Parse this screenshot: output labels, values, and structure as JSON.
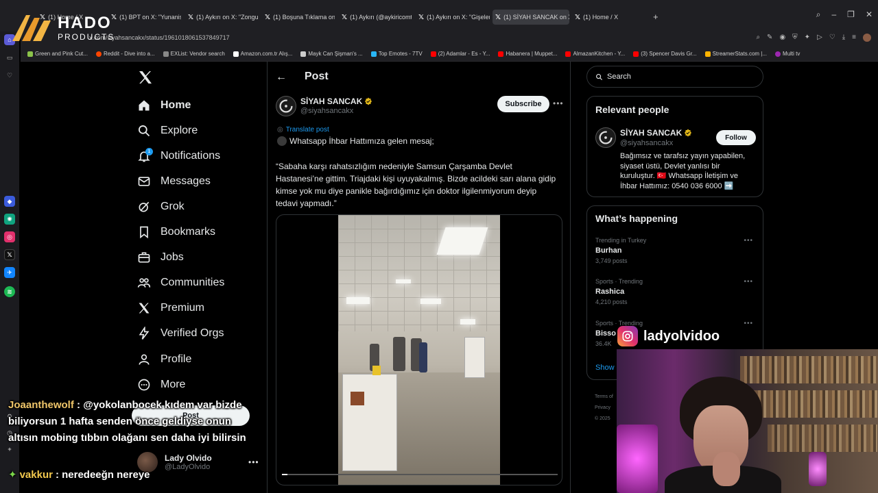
{
  "browser": {
    "tabs": [
      {
        "label": "(1) Home / X",
        "active": false
      },
      {
        "label": "(1) BPT on X: \"Yunanistan",
        "active": false
      },
      {
        "label": "(1) Aykırı on X: \"Zongulda",
        "active": false
      },
      {
        "label": "(1) Boşuna Tıklama on X: \"",
        "active": false
      },
      {
        "label": "(1) Aykırı (@aykiricomtr) /",
        "active": false
      },
      {
        "label": "(1) Aykırı on X: \"Gişelerde",
        "active": false
      },
      {
        "label": "(1) SİYAH SANCAK on X: \"",
        "active": true
      },
      {
        "label": "(1) Home / X",
        "active": false
      }
    ],
    "url": "x.com/siyahsancakx/status/1961018061537849717",
    "bookmarks": [
      "Green and Pink Cut...",
      "Reddit - Dive into a...",
      "EXList: Vendor search",
      "Amazon.com.tr Alış...",
      "Mayk Can Şişman's ...",
      "Top Emotes - 7TV",
      "(2) Adamlar - Es - Y...",
      "Habanera | Muppet...",
      "AlmazanKitchen - Y...",
      "(3) Spencer Davis Gr...",
      "StreamerStats.com |...",
      "Multi tv"
    ]
  },
  "logo": {
    "name": "HADO",
    "sub": "PRODUCTS"
  },
  "nav": {
    "items": [
      "Home",
      "Explore",
      "Notifications",
      "Messages",
      "Grok",
      "Bookmarks",
      "Jobs",
      "Communities",
      "Premium",
      "Verified Orgs",
      "Profile",
      "More"
    ],
    "notifications_badge": "1",
    "post_label": "Post",
    "account_name": "Lady Olvido",
    "account_handle": "@LadyOlvido"
  },
  "post": {
    "header": "Post",
    "author_name": "SİYAH SANCAK",
    "author_handle": "@siyahsancakx",
    "subscribe_label": "Subscribe",
    "translate_label": "Translate post",
    "line1": "Whatsapp İhbar Hattımıza gelen mesaj;",
    "body": "“Sabaha karşı rahatsızlığım nedeniyle Samsun Çarşamba Devlet Hastanesi’ne gittim. Triajdaki kişi uyuyakalmış. Bizde acildeki sarı alana gidip kimse yok mu diye panikle bağırdığımız için doktor ilgilenmiyorum deyip tedavi yapmadı.”",
    "video_progress": 0.02
  },
  "right": {
    "search_placeholder": "Search",
    "relevant_title": "Relevant people",
    "rel_name": "SİYAH SANCAK",
    "rel_handle": "@siyahsancakx",
    "follow_label": "Follow",
    "rel_bio": "Bağımsız ve tarafsız yayın yapabilen, siyaset üstü, Devlet yanlısı bir kuruluştur. 🇹🇷 Whatsapp İletişim ve İhbar Hattımız: 0540 036 6000 ➡️",
    "happening_title": "What’s happening",
    "trends": [
      {
        "meta": "Trending in Turkey",
        "name": "Burhan",
        "count": "3,749 posts"
      },
      {
        "meta": "Sports · Trending",
        "name": "Rashica",
        "count": "4,210 posts"
      },
      {
        "meta": "Sports · Trending",
        "name": "Bisso",
        "count": "36.4K"
      }
    ],
    "show_more": "Show",
    "footer": [
      "Terms of",
      "Privacy",
      "© 2025"
    ]
  },
  "overlay": {
    "chat1_user": "Joaanthewolf",
    "chat1_text": ": @yokolanbocek kıdem var bizde biliyorsun 1 hafta senden önce geldiyse onun altısın mobing tıbbın olağanı sen daha iyi bilirsin",
    "chat2_user": "vakkur",
    "chat2_text": ": neredeeğn nereye",
    "instagram_name": "ladyolvidoo"
  },
  "colors": {
    "accent": "#1d9bf0",
    "background": "#000000",
    "border": "#2f3336"
  }
}
